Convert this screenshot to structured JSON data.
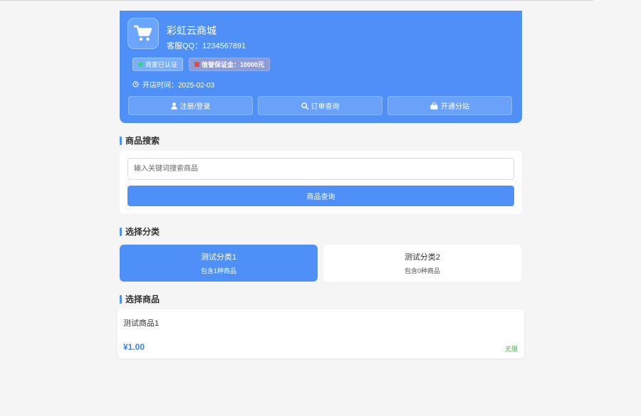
{
  "shop": {
    "name": "彩虹云商城",
    "qq": "客服QQ：1234567891",
    "badge_verified": "商家已认证",
    "badge_deposit": "信誉保证金：10000元",
    "open_time": "开店时间：2025-02-03",
    "colors": {
      "primary": "#4e8ff8",
      "verified_dot": "#3ecf8e",
      "deposit_dot": "#e84a3c"
    }
  },
  "actions": [
    {
      "label": "注册/登录",
      "icon": "user-icon"
    },
    {
      "label": "订单查询",
      "icon": "search-icon"
    },
    {
      "label": "开通分站",
      "icon": "shopping-bag-icon"
    }
  ],
  "search": {
    "title": "商品搜索",
    "placeholder": "输入关键词搜索商品",
    "value": "",
    "button_label": "商品查询"
  },
  "categories": {
    "title": "选择分类",
    "items": [
      {
        "name": "测试分类1",
        "count": "包含1种商品",
        "selected": true
      },
      {
        "name": "测试分类2",
        "count": "包含0种商品",
        "selected": false
      }
    ]
  },
  "products": {
    "title": "选择商品",
    "items": [
      {
        "name": "测试商品1",
        "price": "¥1.00",
        "stock": "无限"
      }
    ]
  }
}
